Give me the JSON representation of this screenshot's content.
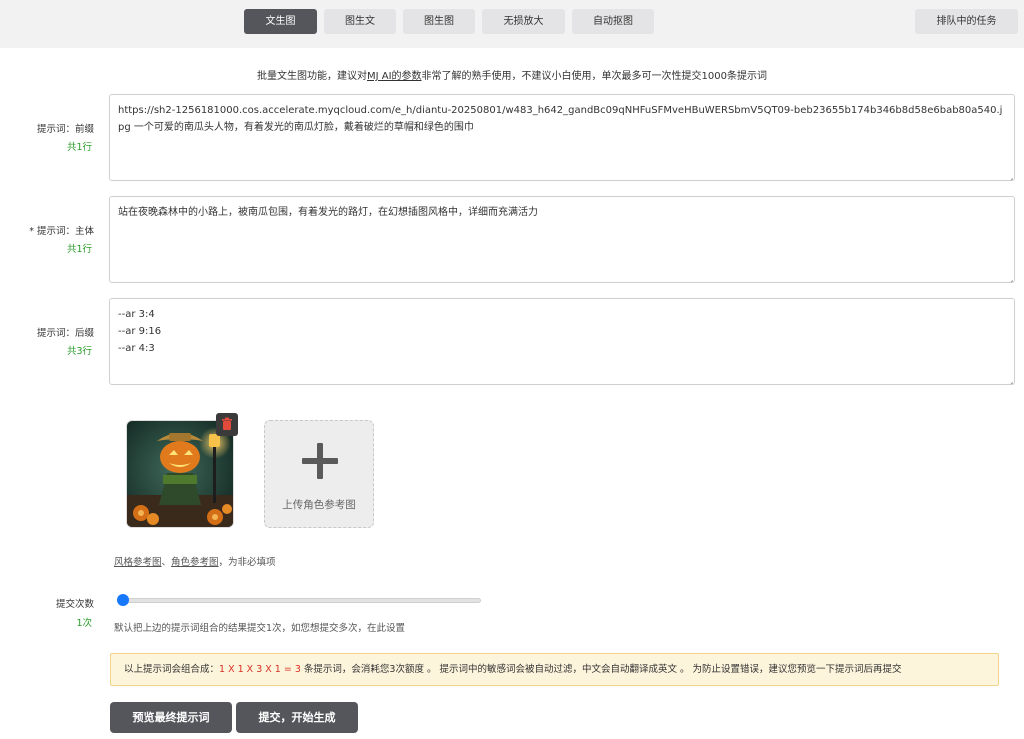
{
  "tabs": [
    {
      "label": "文生图",
      "active": true
    },
    {
      "label": "图生文",
      "active": false
    },
    {
      "label": "图生图",
      "active": false
    },
    {
      "label": "无损放大",
      "active": false
    },
    {
      "label": "自动抠图",
      "active": false
    }
  ],
  "queue_button": "排队中的任务",
  "notice": {
    "prefix": "批量文生图功能，建议对",
    "link": "MJ AI的参数",
    "suffix": "非常了解的熟手使用，不建议小白使用，单次最多可一次性提交1000条提示词"
  },
  "prompt_prefix": {
    "label": "提示词：前缀",
    "count": "共1行",
    "value": "https://sh2-1256181000.cos.accelerate.myqcloud.com/e_h/diantu-20250801/w483_h642_gandBc09qNHFuSFMveHBuWERSbmV5QT09-beb23655b174b346b8d58e6bab80a540.jpg 一个可爱的南瓜头人物，有着发光的南瓜灯脸，戴着破烂的草帽和绿色的围巾"
  },
  "prompt_main": {
    "label": "* 提示词：主体",
    "count": "共1行",
    "value": "站在夜晚森林中的小路上，被南瓜包围，有着发光的路灯，在幻想插图风格中，详细而充满活力"
  },
  "prompt_suffix": {
    "label": "提示词：后缀",
    "count": "共3行",
    "value": "--ar 3:4\n--ar 9:16\n--ar 4:3"
  },
  "upload": {
    "label": "上传角色参考图"
  },
  "ref_note": {
    "style_link": "风格参考图",
    "sep": "、",
    "role_link": "角色参考图",
    "suffix": "，为非必填项"
  },
  "submit_count": {
    "label": "提交次数",
    "value": "1次",
    "slider_fraction": 0.0,
    "help": "默认把上边的提示词组合的结果提交1次，如您想提交多次，在此设置"
  },
  "warning": {
    "prefix": "以上提示词会组合成：",
    "formula": "1 X 1 X 3 X 1 = 3",
    "mid": " 条提示词，会消耗您3次额度 。 提示词中的敏感词会被自动过滤，中文会自动翻译成英文 。 为防止设置错误，建议您预览一下提示词后再提交"
  },
  "buttons": {
    "preview": "预览最终提示词",
    "submit": "提交，开始生成"
  },
  "colors": {
    "accent": "#55565c",
    "count_green": "#2a9d2a",
    "slider_blue": "#1677ff",
    "warn_red": "#d93025",
    "warn_bg": "#fdf4dc"
  }
}
